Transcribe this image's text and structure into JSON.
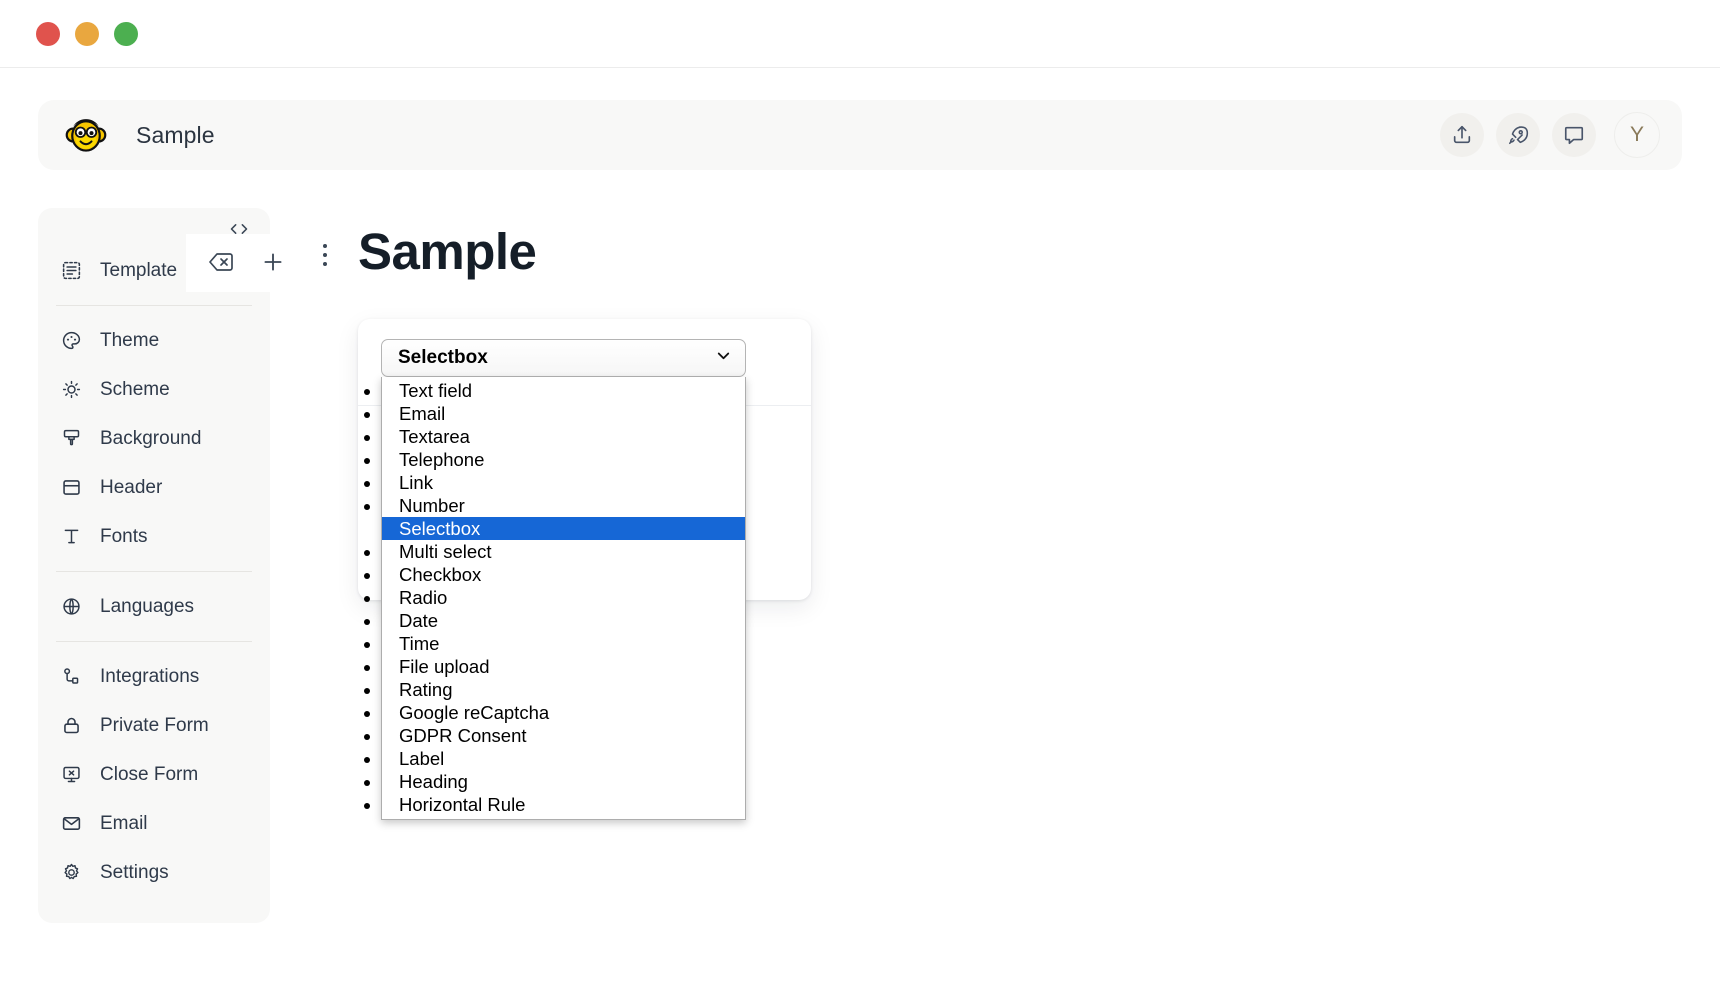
{
  "window": {
    "traffic_lights": [
      "close",
      "minimize",
      "maximize"
    ]
  },
  "appbar": {
    "logo": "monkey-logo",
    "title": "Sample",
    "actions": [
      {
        "name": "share-icon",
        "label": "Share"
      },
      {
        "name": "publish-icon",
        "label": "Publish"
      },
      {
        "name": "comment-icon",
        "label": "Comments"
      }
    ],
    "avatar": "Y"
  },
  "sidebar": {
    "code_toggle": "<>",
    "groups": [
      {
        "items": [
          {
            "icon": "template-icon",
            "label": "Template"
          }
        ]
      },
      {
        "items": [
          {
            "icon": "palette-icon",
            "label": "Theme"
          },
          {
            "icon": "scheme-icon",
            "label": "Scheme"
          },
          {
            "icon": "brush-icon",
            "label": "Background"
          },
          {
            "icon": "header-icon",
            "label": "Header"
          },
          {
            "icon": "text-icon",
            "label": "Fonts"
          }
        ]
      },
      {
        "items": [
          {
            "icon": "globe-icon",
            "label": "Languages"
          }
        ]
      },
      {
        "items": [
          {
            "icon": "integrations-icon",
            "label": "Integrations"
          },
          {
            "icon": "lock-icon",
            "label": "Private Form"
          },
          {
            "icon": "close-form-icon",
            "label": "Close Form"
          },
          {
            "icon": "envelope-icon",
            "label": "Email"
          },
          {
            "icon": "gear-icon",
            "label": "Settings"
          }
        ]
      }
    ]
  },
  "block_toolbar": {
    "buttons": [
      {
        "name": "delete-block-icon",
        "label": "Delete block"
      },
      {
        "name": "add-block-icon",
        "label": "Add block"
      }
    ],
    "kebab": "more-options-icon"
  },
  "main": {
    "page_title": "Sample"
  },
  "field_type_select": {
    "name": "field-type-select",
    "value": "Selectbox",
    "expanded": true,
    "selected_index": 6,
    "options": [
      "Text field",
      "Email",
      "Textarea",
      "Telephone",
      "Link",
      "Number",
      "Selectbox",
      "Multi select",
      "Checkbox",
      "Radio",
      "Date",
      "Time",
      "File upload",
      "Rating",
      "Google reCaptcha",
      "GDPR Consent",
      "Label",
      "Heading",
      "Horizontal Rule"
    ]
  },
  "colors": {
    "accent": "#1667d6",
    "sidebar_bg": "#f8f8f7",
    "text": "#2f3a4a",
    "title": "#151e28"
  }
}
